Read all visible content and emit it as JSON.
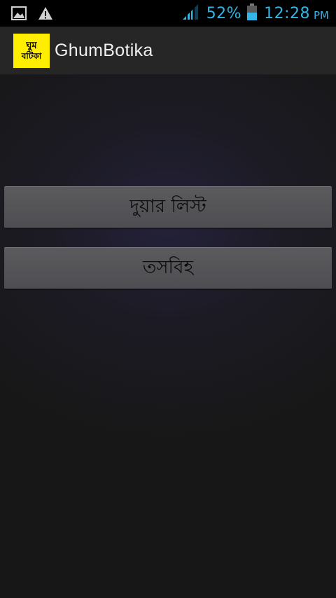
{
  "status_bar": {
    "icons": [
      "gallery-icon",
      "warning-icon"
    ],
    "signal_icon": "signal-icon",
    "battery_percent": "52%",
    "battery_icon": "battery-icon",
    "time": "12:28",
    "ampm": "PM",
    "accent_color": "#33b5e5"
  },
  "action_bar": {
    "logo_line1": "ঘুম",
    "logo_line2": "বটিকা",
    "logo_color": "#ffee00",
    "title": "GhumBotika"
  },
  "menu": {
    "items": [
      {
        "label": "দুয়ার লিস্ট"
      },
      {
        "label": "তসবিহ"
      }
    ]
  }
}
